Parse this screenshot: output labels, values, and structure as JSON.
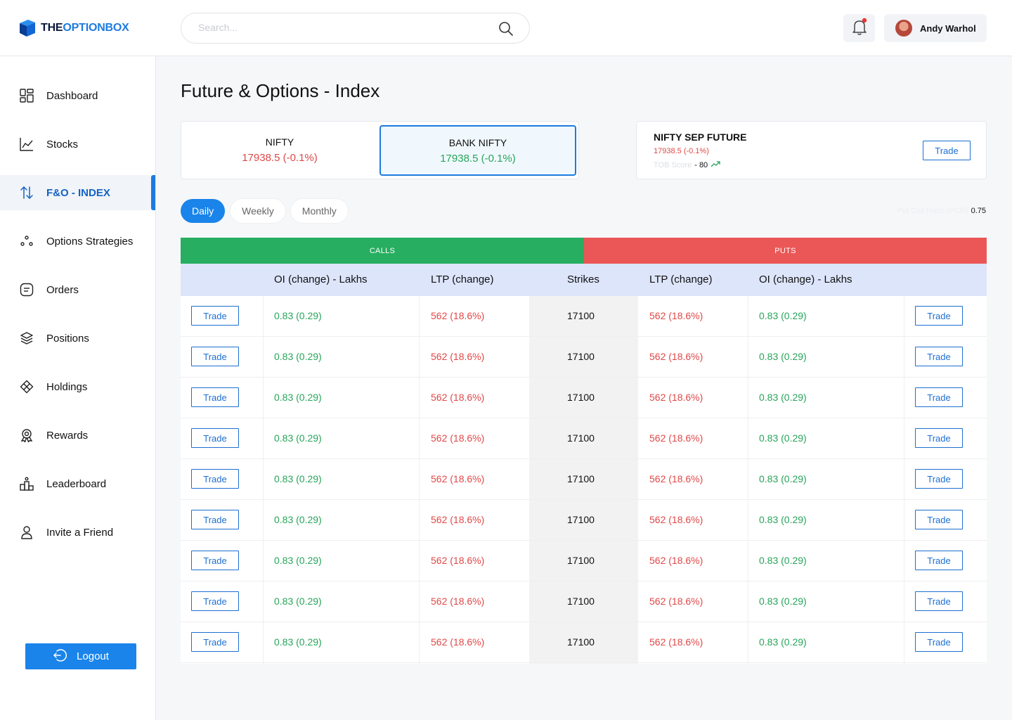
{
  "brand": {
    "part1": "THE",
    "part2": "OPTIONBOX"
  },
  "search": {
    "placeholder": "Search..."
  },
  "user": {
    "name": "Andy Warhol"
  },
  "sidebar": {
    "items": [
      {
        "label": "Dashboard",
        "icon": "dashboard-icon"
      },
      {
        "label": "Stocks",
        "icon": "chart-line-icon"
      },
      {
        "label": "F&O - INDEX",
        "icon": "arrows-updown-icon",
        "active": true
      },
      {
        "label": "Options Strategies",
        "icon": "dots-icon"
      },
      {
        "label": "Orders",
        "icon": "orders-icon"
      },
      {
        "label": "Positions",
        "icon": "layers-icon"
      },
      {
        "label": "Holdings",
        "icon": "holdings-icon"
      },
      {
        "label": "Rewards",
        "icon": "rewards-icon"
      },
      {
        "label": "Leaderboard",
        "icon": "leaderboard-icon"
      },
      {
        "label": "Invite a Friend",
        "icon": "user-icon"
      }
    ],
    "logout_label": "Logout"
  },
  "main": {
    "title": "Future & Options - Index",
    "indices": [
      {
        "name": "NIFTY",
        "value": "17938.5 (-0.1%)",
        "selected": false
      },
      {
        "name": "BANK NIFTY",
        "value": "17938.5 (-0.1%)",
        "selected": true
      }
    ],
    "future": {
      "title": "NIFTY SEP FUTURE",
      "value": "17938.5 (-0.1%)",
      "score_label": "TOB Score",
      "score_value": "- 80",
      "trade_label": "Trade"
    },
    "periods": [
      "Daily",
      "Weekly",
      "Monthly"
    ],
    "active_period": "Daily",
    "pcr": {
      "label": "Put Call Ratio (PCR)",
      "value": "0.75"
    },
    "table": {
      "calls_label": "CALLS",
      "puts_label": "PUTS",
      "headers": {
        "call_oi": "OI (change) - Lakhs",
        "call_ltp": "LTP (change)",
        "strikes": "Strikes",
        "put_ltp": "LTP (change)",
        "put_oi": "OI (change) - Lakhs"
      },
      "trade_label": "Trade",
      "rows": [
        {
          "call_oi": "0.83 (0.29)",
          "call_ltp": "562 (18.6%)",
          "strike": "17100",
          "put_ltp": "562 (18.6%)",
          "put_oi": "0.83 (0.29)"
        },
        {
          "call_oi": "0.83 (0.29)",
          "call_ltp": "562 (18.6%)",
          "strike": "17100",
          "put_ltp": "562 (18.6%)",
          "put_oi": "0.83 (0.29)"
        },
        {
          "call_oi": "0.83 (0.29)",
          "call_ltp": "562 (18.6%)",
          "strike": "17100",
          "put_ltp": "562 (18.6%)",
          "put_oi": "0.83 (0.29)"
        },
        {
          "call_oi": "0.83 (0.29)",
          "call_ltp": "562 (18.6%)",
          "strike": "17100",
          "put_ltp": "562 (18.6%)",
          "put_oi": "0.83 (0.29)"
        },
        {
          "call_oi": "0.83 (0.29)",
          "call_ltp": "562 (18.6%)",
          "strike": "17100",
          "put_ltp": "562 (18.6%)",
          "put_oi": "0.83 (0.29)"
        },
        {
          "call_oi": "0.83 (0.29)",
          "call_ltp": "562 (18.6%)",
          "strike": "17100",
          "put_ltp": "562 (18.6%)",
          "put_oi": "0.83 (0.29)"
        },
        {
          "call_oi": "0.83 (0.29)",
          "call_ltp": "562 (18.6%)",
          "strike": "17100",
          "put_ltp": "562 (18.6%)",
          "put_oi": "0.83 (0.29)"
        },
        {
          "call_oi": "0.83 (0.29)",
          "call_ltp": "562 (18.6%)",
          "strike": "17100",
          "put_ltp": "562 (18.6%)",
          "put_oi": "0.83 (0.29)"
        },
        {
          "call_oi": "0.83 (0.29)",
          "call_ltp": "562 (18.6%)",
          "strike": "17100",
          "put_ltp": "562 (18.6%)",
          "put_oi": "0.83 (0.29)"
        }
      ]
    }
  },
  "colors": {
    "accent": "#1a84ea",
    "calls": "#27ae60",
    "puts": "#eb5757",
    "up": "#27a55a",
    "down": "#e04848"
  }
}
